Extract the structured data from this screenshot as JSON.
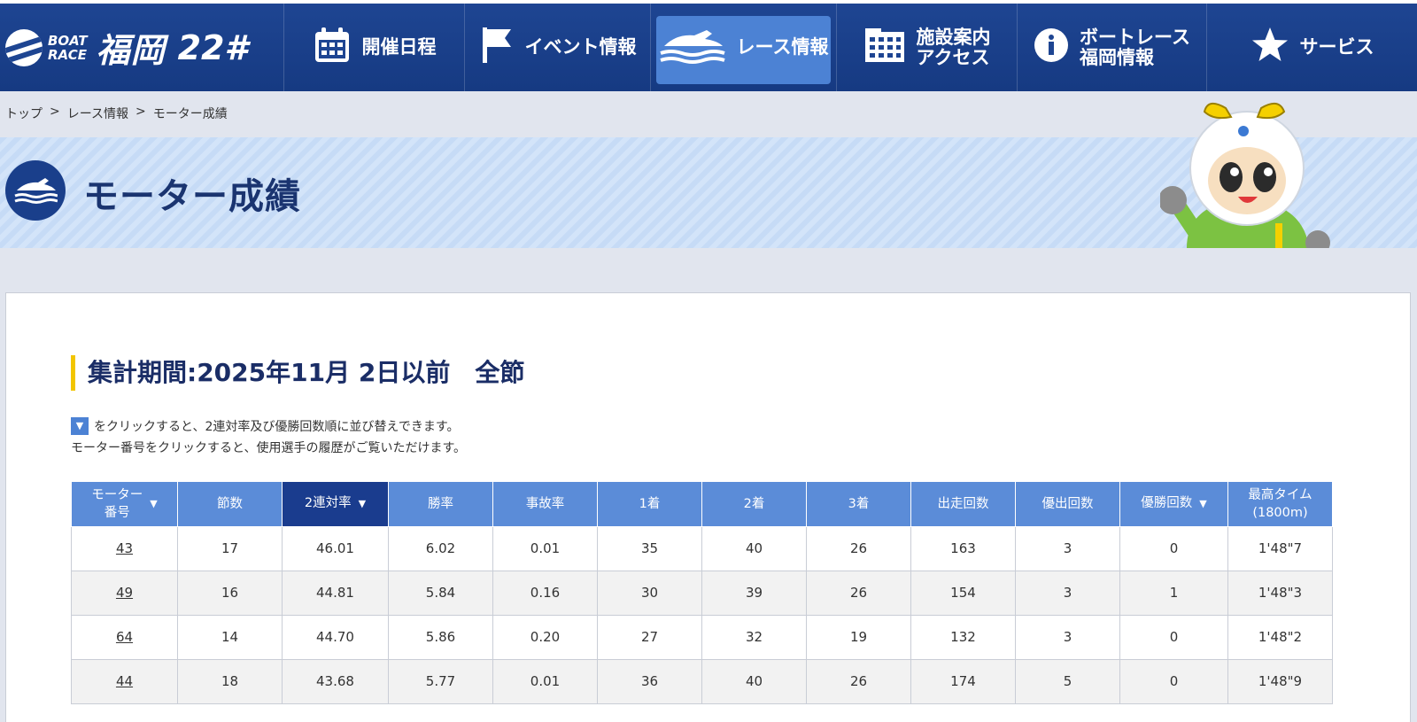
{
  "header": {
    "logo": {
      "boat": "BOAT",
      "race": "RACE",
      "name": "福岡",
      "number": "22#"
    },
    "nav": [
      {
        "label": "開催日程",
        "icon": "calendar-icon"
      },
      {
        "label": "イベント情報",
        "icon": "flag-icon"
      },
      {
        "label": "レース情報",
        "icon": "boat-icon",
        "active": true
      },
      {
        "label": "施設案内\nアクセス",
        "icon": "building-icon"
      },
      {
        "label": "ボートレース\n福岡情報",
        "icon": "info-icon"
      },
      {
        "label": "サービス",
        "icon": "star-icon"
      }
    ]
  },
  "breadcrumb": [
    "トップ",
    "レース情報",
    "モーター成績"
  ],
  "breadcrumb_sep": ">",
  "page_title": "モーター成績",
  "period_title": "集計期間:2025年11月 2日以前　全節",
  "notes": {
    "sort_chip": "▼",
    "line1": "をクリックすると、2連対率及び優勝回数順に並び替えできます。",
    "line2": "モーター番号をクリックすると、使用選手の履歴がご覧いただけます。"
  },
  "table": {
    "headers": [
      {
        "label": "モーター\n番号",
        "sortable": true
      },
      {
        "label": "節数"
      },
      {
        "label": "2連対率",
        "sortable": true,
        "sorted": true
      },
      {
        "label": "勝率"
      },
      {
        "label": "事故率"
      },
      {
        "label": "1着"
      },
      {
        "label": "2着"
      },
      {
        "label": "3着"
      },
      {
        "label": "出走回数"
      },
      {
        "label": "優出回数"
      },
      {
        "label": "優勝回数",
        "sortable": true
      },
      {
        "label": "最高タイム\n(1800m)"
      }
    ],
    "rows": [
      [
        "43",
        "17",
        "46.01",
        "6.02",
        "0.01",
        "35",
        "40",
        "26",
        "163",
        "3",
        "0",
        "1'48\"7"
      ],
      [
        "49",
        "16",
        "44.81",
        "5.84",
        "0.16",
        "30",
        "39",
        "26",
        "154",
        "3",
        "1",
        "1'48\"3"
      ],
      [
        "64",
        "14",
        "44.70",
        "5.86",
        "0.20",
        "27",
        "32",
        "19",
        "132",
        "3",
        "0",
        "1'48\"2"
      ],
      [
        "44",
        "18",
        "43.68",
        "5.77",
        "0.01",
        "36",
        "40",
        "26",
        "174",
        "5",
        "0",
        "1'48\"9"
      ]
    ]
  },
  "colors": {
    "header": "#1e4592",
    "nav_active": "#4c82d4",
    "table_header": "#5b8cd8",
    "table_header_sorted": "#1a3c8e",
    "accent_bar": "#f2c500",
    "title_text": "#1a3470"
  }
}
